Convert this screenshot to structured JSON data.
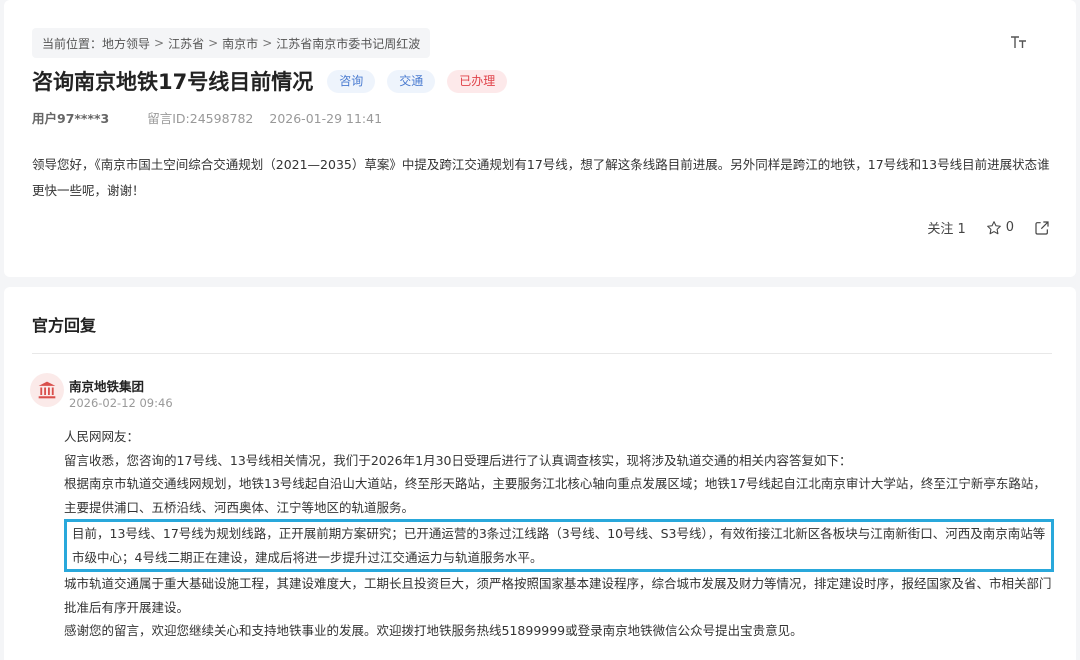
{
  "breadcrumb": {
    "prefix": "当前位置：",
    "items": [
      "地方领导",
      "江苏省",
      "南京市",
      "江苏省南京市委书记周红波"
    ],
    "separator": ">"
  },
  "font_size_icon": "font-size-icon",
  "question": {
    "title": "咨询南京地铁17号线目前情况",
    "tags": [
      {
        "label": "咨询",
        "color": "#4a7bd0"
      },
      {
        "label": "交通",
        "color": "#4a7bd0"
      },
      {
        "label": "已办理",
        "color": "#e0434a"
      }
    ],
    "user": "用户97****3",
    "message_id": "留言ID:24598782",
    "datetime": "2026-01-29 11:41",
    "body": "领导您好，《南京市国土空间综合交通规划（2021—2035）草案》中提及跨江交通规划有17号线，想了解这条线路目前进展。另外同样是跨江的地铁，17号线和13号线目前进展状态谁更快一些呢，谢谢！",
    "follow_label": "关注 1",
    "like_count": "0"
  },
  "reply": {
    "section_title": "官方回复",
    "org_icon": "government-building-icon",
    "org_name": "南京地铁集团",
    "datetime": "2026-02-12 09:46",
    "greeting": "人民网网友：",
    "paragraphs": [
      "留言收悉，您咨询的17号线、13号线相关情况，我们于2026年1月30日受理后进行了认真调查核实，现将涉及轨道交通的相关内容答复如下：",
      "根据南京市轨道交通线网规划，地铁13号线起自沿山大道站，终至彤天路站，主要服务江北核心轴向重点发展区域；地铁17号线起自江北南京审计大学站，终至江宁新亭东路站，主要提供浦口、五桥沿线、河西奥体、江宁等地区的轨道服务。",
      "目前，13号线、17号线为规划线路，正开展前期方案研究；已开通运营的3条过江线路（3号线、10号线、S3号线），有效衔接江北新区各板块与江南新街口、河西及南京南站等市级中心；4号线二期正在建设，建成后将进一步提升过江交通运力与轨道服务水平。",
      "城市轨道交通属于重大基础设施工程，其建设难度大，工期长且投资巨大，须严格按照国家基本建设程序，综合城市发展及财力等情况，排定建设时序，报经国家及省、市相关部门批准后有序开展建设。",
      "感谢您的留言，欢迎您继续关心和支持地铁事业的发展。欢迎拨打地铁服务热线51899999或登录南京地铁微信公众号提出宝贵意见。"
    ],
    "highlight_color": "#29a8db"
  }
}
